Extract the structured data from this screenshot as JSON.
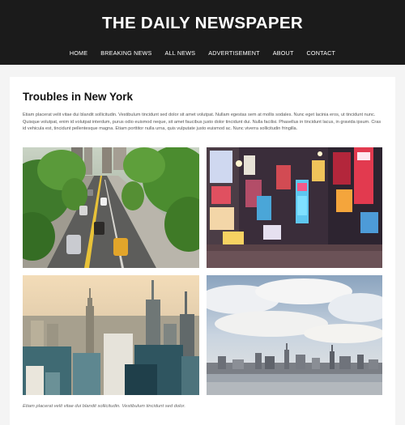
{
  "site": {
    "title": "THE DAILY NEWSPAPER"
  },
  "nav": {
    "items": [
      {
        "label": "HOME"
      },
      {
        "label": "BREAKING NEWS"
      },
      {
        "label": "ALL NEWS"
      },
      {
        "label": "ADVERTISEMENT"
      },
      {
        "label": "ABOUT"
      },
      {
        "label": "CONTACT"
      }
    ]
  },
  "article": {
    "title": "Troubles in New York",
    "lead": "Etiam placerat velit vitae dui blandit sollicitudin. Vestibulum tincidunt sed dolor sit amet volutpat. Nullam egestas sem at mollis sodales. Nunc eget lacinia eros, ut tincidunt nunc. Quisque volutpat, enim id volutpat interdum, purus odio euismod neque, sit amet faucibus justo dolor tincidunt dui. Nulla facilisi. Phasellus in tincidunt lacus, in gravida ipsum. Cras id vehicula est, tincidunt pellentesque magna. Etiam porttitor nulla urna, quis vulputate justo euismod ac. Nunc viverra sollicitudin fringilla.",
    "caption": "Etiam placerat velit vitae dui blandit sollicitudin. Vestibulum tincidunt sed dolor."
  },
  "colors": {
    "header_bg": "#1b1b1b",
    "page_bg": "#f4f4f4",
    "card_bg": "#ffffff"
  }
}
